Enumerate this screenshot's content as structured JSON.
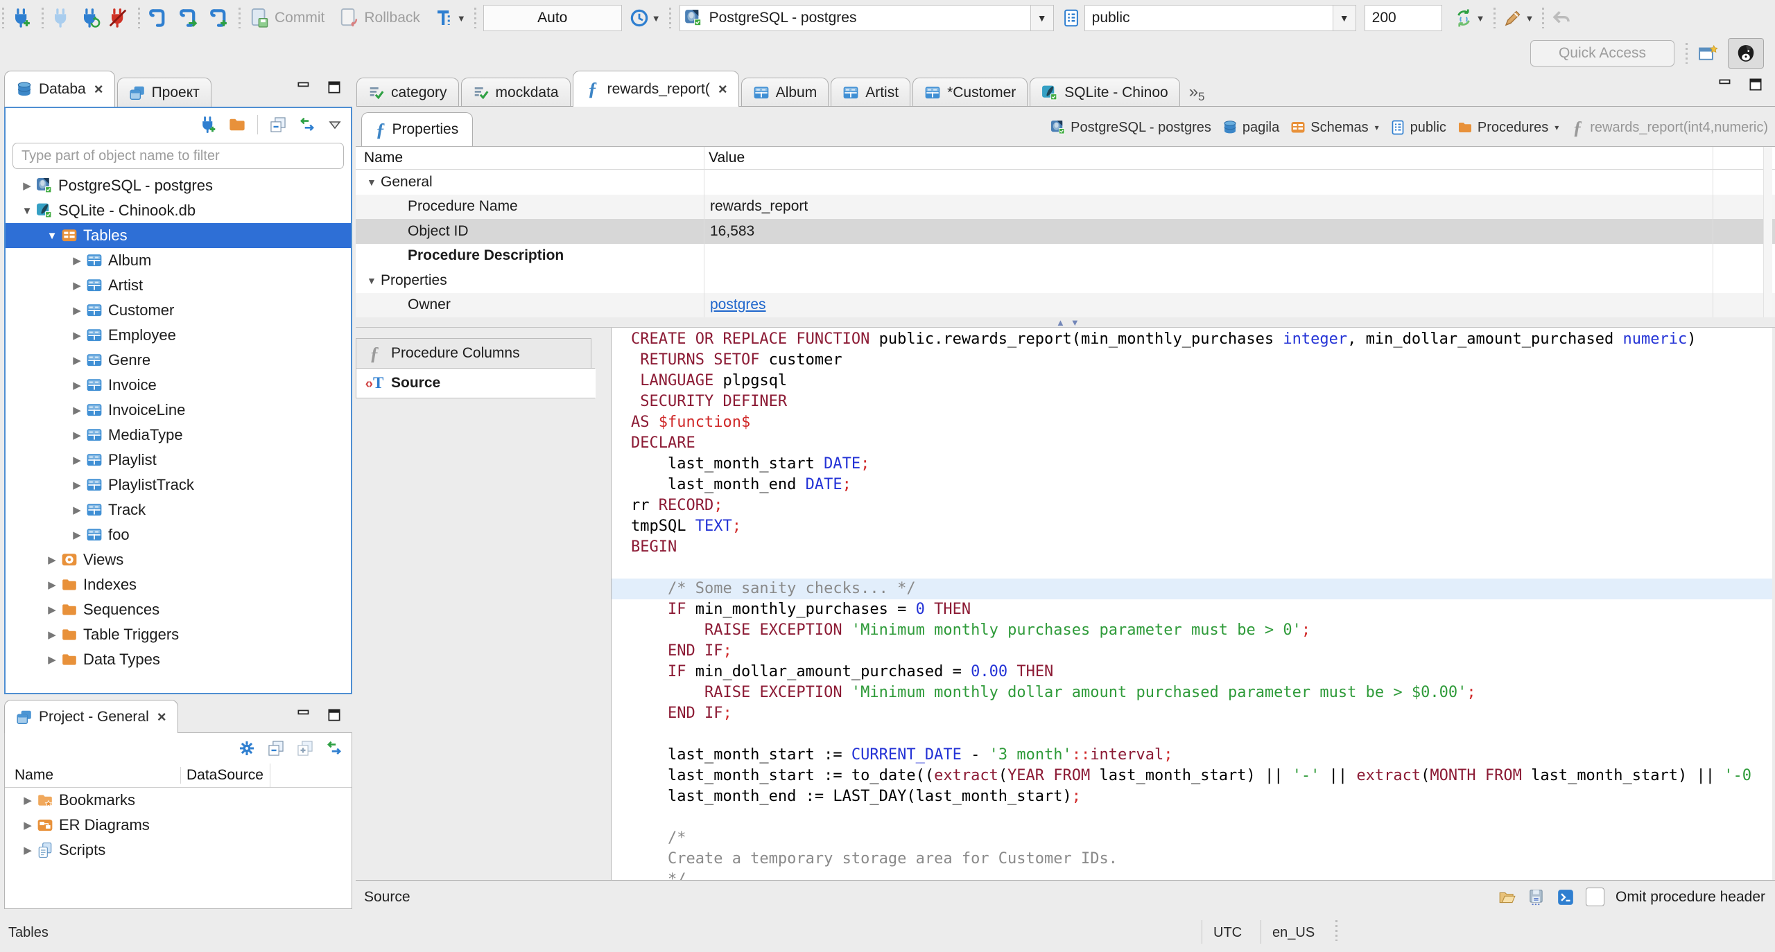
{
  "toolbar": {
    "commit_label": "Commit",
    "rollback_label": "Rollback",
    "auto_commit": "Auto",
    "connection": "PostgreSQL - postgres",
    "schema": "public",
    "fetch_size": "200",
    "quick_access": "Quick Access"
  },
  "editor_tabs": {
    "overflow_count": "5",
    "tabs": [
      {
        "label": "category",
        "icon": "sql-script"
      },
      {
        "label": "mockdata",
        "icon": "sql-script"
      },
      {
        "label": "rewards_report(",
        "icon": "function",
        "selected": true,
        "closable": true
      },
      {
        "label": "Album",
        "icon": "table"
      },
      {
        "label": "Artist",
        "icon": "table"
      },
      {
        "label": "*Customer",
        "icon": "table"
      },
      {
        "label": "SQLite - Chinoo",
        "icon": "sqlite-connection"
      }
    ]
  },
  "navigator": {
    "tab_database": "Databa",
    "tab_project": "Проект",
    "filter_placeholder": "Type part of object name to filter",
    "tree": [
      {
        "label": "PostgreSQL - postgres",
        "icon": "postgres-connection",
        "level": 0,
        "arrow": "collapsed"
      },
      {
        "label": "SQLite - Chinook.db",
        "icon": "sqlite-connection",
        "level": 0,
        "arrow": "expanded"
      },
      {
        "label": "Tables",
        "icon": "tables-folder",
        "level": 1,
        "arrow": "expanded",
        "selected": true
      },
      {
        "label": "Album",
        "icon": "table",
        "level": 2,
        "arrow": "collapsed"
      },
      {
        "label": "Artist",
        "icon": "table",
        "level": 2,
        "arrow": "collapsed"
      },
      {
        "label": "Customer",
        "icon": "table",
        "level": 2,
        "arrow": "collapsed"
      },
      {
        "label": "Employee",
        "icon": "table",
        "level": 2,
        "arrow": "collapsed"
      },
      {
        "label": "Genre",
        "icon": "table",
        "level": 2,
        "arrow": "collapsed"
      },
      {
        "label": "Invoice",
        "icon": "table",
        "level": 2,
        "arrow": "collapsed"
      },
      {
        "label": "InvoiceLine",
        "icon": "table",
        "level": 2,
        "arrow": "collapsed"
      },
      {
        "label": "MediaType",
        "icon": "table",
        "level": 2,
        "arrow": "collapsed"
      },
      {
        "label": "Playlist",
        "icon": "table",
        "level": 2,
        "arrow": "collapsed"
      },
      {
        "label": "PlaylistTrack",
        "icon": "table",
        "level": 2,
        "arrow": "collapsed"
      },
      {
        "label": "Track",
        "icon": "table",
        "level": 2,
        "arrow": "collapsed"
      },
      {
        "label": "foo",
        "icon": "table",
        "level": 2,
        "arrow": "collapsed"
      },
      {
        "label": "Views",
        "icon": "views-folder",
        "level": 1,
        "arrow": "collapsed"
      },
      {
        "label": "Indexes",
        "icon": "folder",
        "level": 1,
        "arrow": "collapsed"
      },
      {
        "label": "Sequences",
        "icon": "folder",
        "level": 1,
        "arrow": "collapsed"
      },
      {
        "label": "Table Triggers",
        "icon": "folder",
        "level": 1,
        "arrow": "collapsed"
      },
      {
        "label": "Data Types",
        "icon": "folder",
        "level": 1,
        "arrow": "collapsed"
      }
    ]
  },
  "project_panel": {
    "title": "Project - General",
    "col_name": "Name",
    "col_datasource": "DataSource",
    "items": [
      {
        "label": "Bookmarks",
        "icon": "bookmarks-folder"
      },
      {
        "label": "ER Diagrams",
        "icon": "er-diagrams"
      },
      {
        "label": "Scripts",
        "icon": "scripts"
      }
    ]
  },
  "object_editor": {
    "tab_label": "Properties",
    "breadcrumb": [
      {
        "label": "PostgreSQL - postgres",
        "icon": "postgres-connection"
      },
      {
        "label": "pagila",
        "icon": "database-cylinder"
      },
      {
        "label": "Schemas",
        "icon": "tables-folder",
        "dropdown": true
      },
      {
        "label": "public",
        "icon": "schema"
      },
      {
        "label": "Procedures",
        "icon": "folder",
        "dropdown": true
      },
      {
        "label": "rewards_report(int4,numeric)",
        "icon": "function-gray",
        "muted": true
      }
    ],
    "grid": {
      "col_name": "Name",
      "col_value": "Value",
      "rows": [
        {
          "group": true,
          "name": "General"
        },
        {
          "name": "Procedure Name",
          "value": "rewards_report",
          "stripe": true
        },
        {
          "name": "Object ID",
          "value": "16,583",
          "selected": true
        },
        {
          "name": "Procedure Description",
          "bold": true
        },
        {
          "group": true,
          "name": "Properties"
        },
        {
          "name": "Owner",
          "value": "postgres",
          "link": true,
          "stripe": true
        }
      ]
    },
    "subtabs": [
      {
        "label": "Procedure Columns",
        "icon": "function-gray"
      },
      {
        "label": "Source",
        "icon": "source",
        "selected": true
      }
    ],
    "bottom": {
      "status": "Source",
      "omit_label": "Omit procedure header"
    }
  },
  "source_code": {
    "lines": [
      {
        "tokens": [
          [
            "k",
            "CREATE OR REPLACE FUNCTION"
          ],
          [
            "",
            " public.rewards_report(min_monthly_purchases "
          ],
          [
            "t",
            "integer"
          ],
          [
            "",
            ", min_dollar_amount_purchased "
          ],
          [
            "t",
            "numeric"
          ],
          [
            "",
            ")"
          ]
        ]
      },
      {
        "tokens": [
          [
            "",
            " "
          ],
          [
            "k",
            "RETURNS SETOF"
          ],
          [
            "",
            " customer"
          ]
        ]
      },
      {
        "tokens": [
          [
            "",
            " "
          ],
          [
            "k",
            "LANGUAGE"
          ],
          [
            "",
            " plpgsql"
          ]
        ]
      },
      {
        "tokens": [
          [
            "",
            " "
          ],
          [
            "k",
            "SECURITY DEFINER"
          ]
        ]
      },
      {
        "tokens": [
          [
            "k",
            "AS"
          ],
          [
            "d",
            " $function$"
          ]
        ]
      },
      {
        "tokens": [
          [
            "k",
            "DECLARE"
          ]
        ]
      },
      {
        "tokens": [
          [
            "",
            "    last_month_start "
          ],
          [
            "t",
            "DATE"
          ],
          [
            "p",
            ";"
          ]
        ]
      },
      {
        "tokens": [
          [
            "",
            "    last_month_end "
          ],
          [
            "t",
            "DATE"
          ],
          [
            "p",
            ";"
          ]
        ]
      },
      {
        "tokens": [
          [
            "",
            "rr "
          ],
          [
            "k",
            "RECORD"
          ],
          [
            "p",
            ";"
          ]
        ]
      },
      {
        "tokens": [
          [
            "",
            "tmpSQL "
          ],
          [
            "t",
            "TEXT"
          ],
          [
            "p",
            ";"
          ]
        ]
      },
      {
        "tokens": [
          [
            "k",
            "BEGIN"
          ]
        ]
      },
      {
        "tokens": []
      },
      {
        "hl": true,
        "tokens": [
          [
            "c",
            "    /* Some sanity checks... */"
          ]
        ]
      },
      {
        "tokens": [
          [
            "",
            "    "
          ],
          [
            "k",
            "IF"
          ],
          [
            "",
            " min_monthly_purchases = "
          ],
          [
            "n",
            "0"
          ],
          [
            "k",
            " THEN"
          ]
        ]
      },
      {
        "tokens": [
          [
            "",
            "        "
          ],
          [
            "k",
            "RAISE EXCEPTION"
          ],
          [
            "",
            " "
          ],
          [
            "s",
            "'Minimum monthly purchases parameter must be > 0'"
          ],
          [
            "p",
            ";"
          ]
        ]
      },
      {
        "tokens": [
          [
            "",
            "    "
          ],
          [
            "k",
            "END IF"
          ],
          [
            "p",
            ";"
          ]
        ]
      },
      {
        "tokens": [
          [
            "",
            "    "
          ],
          [
            "k",
            "IF"
          ],
          [
            "",
            " min_dollar_amount_purchased = "
          ],
          [
            "n",
            "0.00"
          ],
          [
            "k",
            " THEN"
          ]
        ]
      },
      {
        "tokens": [
          [
            "",
            "        "
          ],
          [
            "k",
            "RAISE EXCEPTION"
          ],
          [
            "",
            " "
          ],
          [
            "s",
            "'Minimum monthly dollar amount purchased parameter must be > $0.00'"
          ],
          [
            "p",
            ";"
          ]
        ]
      },
      {
        "tokens": [
          [
            "",
            "    "
          ],
          [
            "k",
            "END IF"
          ],
          [
            "p",
            ";"
          ]
        ]
      },
      {
        "tokens": []
      },
      {
        "tokens": [
          [
            "",
            "    last_month_start := "
          ],
          [
            "t",
            "CURRENT_DATE"
          ],
          [
            "",
            " - "
          ],
          [
            "s",
            "'3 month'"
          ],
          [
            "p",
            "::"
          ],
          [
            "k",
            "interval"
          ],
          [
            "p",
            ";"
          ]
        ]
      },
      {
        "tokens": [
          [
            "",
            "    last_month_start := to_date(("
          ],
          [
            "k",
            "extract"
          ],
          [
            "",
            "("
          ],
          [
            "k",
            "YEAR FROM"
          ],
          [
            "",
            " last_month_start) || "
          ],
          [
            "s",
            "'-'"
          ],
          [
            "",
            " || "
          ],
          [
            "k",
            "extract"
          ],
          [
            "",
            "("
          ],
          [
            "k",
            "MONTH FROM"
          ],
          [
            "",
            " last_month_start) || "
          ],
          [
            "s",
            "'-0"
          ]
        ]
      },
      {
        "tokens": [
          [
            "",
            "    last_month_end := LAST_DAY(last_month_start)"
          ],
          [
            "p",
            ";"
          ]
        ]
      },
      {
        "tokens": []
      },
      {
        "tokens": [
          [
            "c",
            "    /*"
          ]
        ]
      },
      {
        "tokens": [
          [
            "c",
            "    Create a temporary storage area for Customer IDs."
          ]
        ]
      },
      {
        "tokens": [
          [
            "c",
            "    */"
          ]
        ]
      }
    ]
  },
  "status_bar": {
    "left": "Tables",
    "timezone": "UTC",
    "locale": "en_US"
  }
}
